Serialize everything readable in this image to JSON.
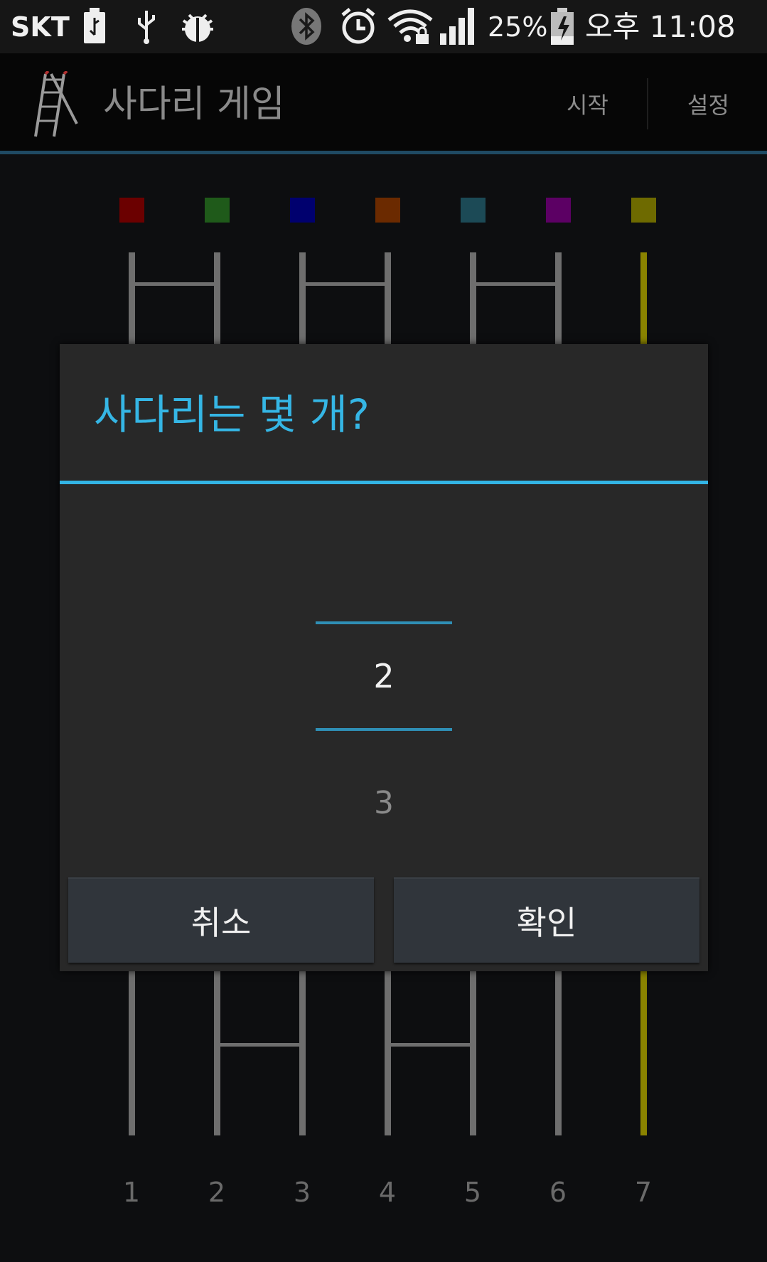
{
  "status_bar": {
    "carrier": "SKT",
    "battery_percent": "25%",
    "time": "오후 11:08",
    "icons": [
      "usb-storage-icon",
      "usb-icon",
      "debug-bug-icon",
      "bluetooth-icon",
      "alarm-icon",
      "wifi-lock-icon",
      "signal-icon",
      "battery-charging-icon"
    ]
  },
  "action_bar": {
    "title": "사다리 게임",
    "start_label": "시작",
    "settings_label": "설정",
    "icon": "ladder-icon"
  },
  "board": {
    "player_colors": [
      "#6b0000",
      "#1f5a1a",
      "#00006e",
      "#6b2a00",
      "#1c4a56",
      "#5c0064",
      "#6e6a00"
    ],
    "column_numbers": [
      "1",
      "2",
      "3",
      "4",
      "5",
      "6",
      "7"
    ],
    "highlight_rail_color": "#8a8300",
    "rail_color": "#6e6e6e"
  },
  "dialog": {
    "title": "사다리는 몇 개?",
    "picker_value": "2",
    "picker_next": "3",
    "cancel_label": "취소",
    "ok_label": "확인",
    "accent": "#33b5e5"
  }
}
